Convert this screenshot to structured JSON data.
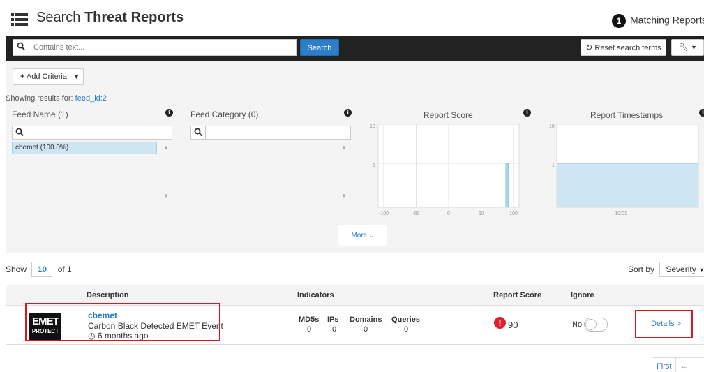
{
  "header": {
    "title_prefix": "Search",
    "title_bold": "Threat Reports",
    "match_count": "1",
    "match_label": "Matching Reports"
  },
  "search": {
    "placeholder": "Contains text...",
    "search_label": "Search",
    "reset_label": "Reset search terms"
  },
  "criteria": {
    "add_label": "Add Criteria",
    "showing_prefix": "Showing results for:",
    "showing_value": "feed_id:2"
  },
  "facets": [
    {
      "title": "Feed Name (1)",
      "items": [
        {
          "label": "cbemet (100.0%)",
          "selected": true
        }
      ]
    },
    {
      "title": "Feed Category (0)",
      "items": []
    }
  ],
  "charts": [
    {
      "title": "Report Score",
      "chart_data": {
        "type": "bar",
        "ylabel_ticks": [
          "10",
          "1"
        ],
        "xticks": [
          "-100",
          "-50",
          "0",
          "50",
          "100"
        ],
        "xlim": [
          -100,
          100
        ],
        "bars": [
          {
            "x": 90,
            "count": 1
          }
        ],
        "yscale": "log"
      }
    },
    {
      "title": "Report Timestamps",
      "chart_data": {
        "type": "area",
        "ylabel_ticks": [
          "10",
          "1"
        ],
        "xticks": [
          "10/01"
        ],
        "count": 1,
        "yscale": "log"
      }
    }
  ],
  "more_label": "More",
  "results": {
    "show_label": "Show",
    "page_size": "10",
    "of_label": "of 1",
    "sort_label": "Sort by",
    "sort_value": "Severity",
    "columns": [
      "Description",
      "Indicators",
      "Report Score",
      "Ignore"
    ],
    "rows": [
      {
        "logo_line1": "EMET",
        "logo_line2": "PROTECT",
        "name": "cbemet",
        "description": "Carbon Black Detected EMET Event",
        "time": "6 months ago",
        "indicators": [
          {
            "label": "MD5s",
            "value": "0"
          },
          {
            "label": "IPs",
            "value": "0"
          },
          {
            "label": "Domains",
            "value": "0"
          },
          {
            "label": "Queries",
            "value": "0"
          }
        ],
        "score": "90",
        "ignore": "No",
        "details": "Details >"
      }
    ]
  },
  "pager": {
    "first": "First",
    "prev": "←"
  },
  "colors": {
    "accent": "#2d7ec8",
    "dark_bar": "#222222",
    "bar_fill": "#cde6f2",
    "danger": "#d9232d"
  }
}
